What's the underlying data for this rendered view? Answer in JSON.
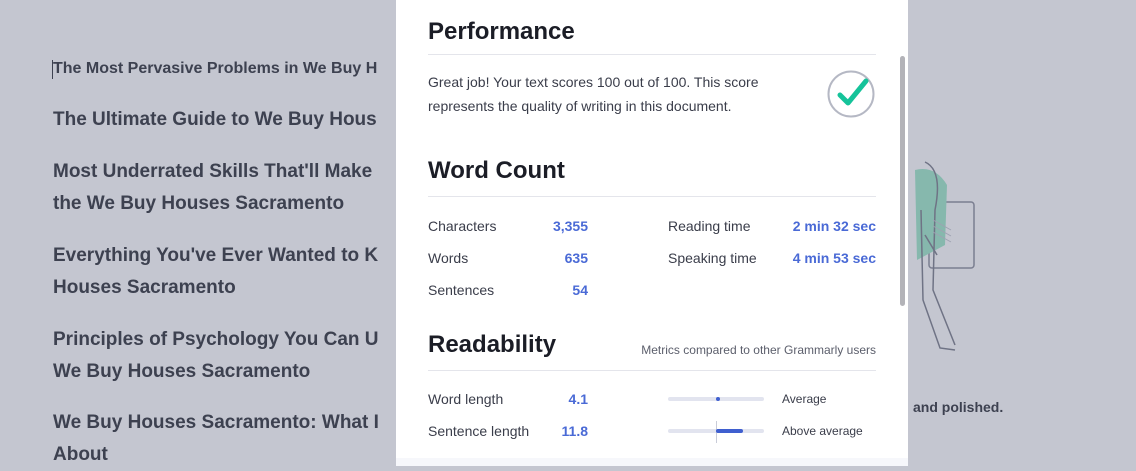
{
  "background": {
    "first_line": "The Most Pervasive Problems in We Buy H",
    "items": [
      [
        "The Ultimate Guide to We Buy Hous"
      ],
      [
        "Most Underrated Skills That'll Make",
        "the We Buy Houses Sacramento"
      ],
      [
        "Everything You've Ever Wanted to K",
        "Houses Sacramento"
      ],
      [
        "Principles of Psychology You Can U",
        "We Buy Houses Sacramento"
      ],
      [
        "We Buy Houses Sacramento: What I",
        "About"
      ]
    ],
    "side_text": "and polished."
  },
  "performance": {
    "title": "Performance",
    "text": "Great job! Your text scores 100 out of 100. This score represents the quality of writing in this document.",
    "score": 100,
    "check_color": "#15c39a"
  },
  "word_count": {
    "title": "Word Count",
    "left": [
      {
        "label": "Characters",
        "value": "3,355"
      },
      {
        "label": "Words",
        "value": "635"
      },
      {
        "label": "Sentences",
        "value": "54"
      }
    ],
    "right": [
      {
        "label": "Reading time",
        "value": "2 min 32 sec"
      },
      {
        "label": "Speaking time",
        "value": "4 min 53 sec"
      }
    ]
  },
  "readability": {
    "title": "Readability",
    "note": "Metrics compared to other Grammarly users",
    "metrics": [
      {
        "label": "Word length",
        "value": "4.1",
        "comparison": "Average",
        "level": 0.52
      },
      {
        "label": "Sentence length",
        "value": "11.8",
        "comparison": "Above average",
        "level": 0.78
      }
    ]
  },
  "colors": {
    "accent": "#4a6ad6",
    "bar_fill": "#3f5fcf"
  }
}
